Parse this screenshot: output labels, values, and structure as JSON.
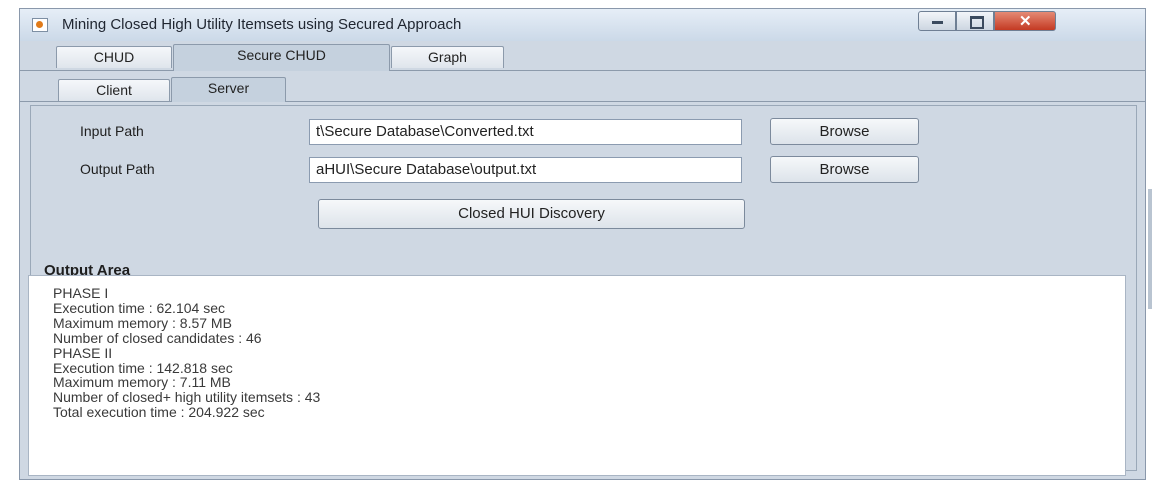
{
  "window": {
    "title": "Mining Closed High Utility Itemsets using Secured Approach",
    "controls": {
      "minimize": "minimize",
      "maximize": "maximize",
      "close": "x"
    }
  },
  "tabs": [
    {
      "label": "CHUD",
      "active": false
    },
    {
      "label": "Secure CHUD",
      "active": true
    },
    {
      "label": "Graph",
      "active": false
    }
  ],
  "subtabs": [
    {
      "label": "Client",
      "active": false
    },
    {
      "label": "Server",
      "active": true
    }
  ],
  "form": {
    "input_path": {
      "label": "Input Path",
      "value": "t\\Secure Database\\Converted.txt",
      "browse": "Browse"
    },
    "output_path": {
      "label": "Output Path",
      "value": "aHUI\\Secure Database\\output.txt",
      "browse": "Browse"
    },
    "discover_button": "Closed HUI Discovery"
  },
  "output": {
    "header": "Output Area",
    "lines": [
      "PHASE I",
      "Execution time : 62.104 sec",
      "Maximum memory : 8.57 MB",
      "Number of closed candidates : 46",
      "PHASE II",
      "Execution time : 142.818 sec",
      "Maximum memory : 7.11 MB",
      "Number of closed+ high utility itemsets : 43",
      "Total execution time : 204.922 sec"
    ]
  }
}
